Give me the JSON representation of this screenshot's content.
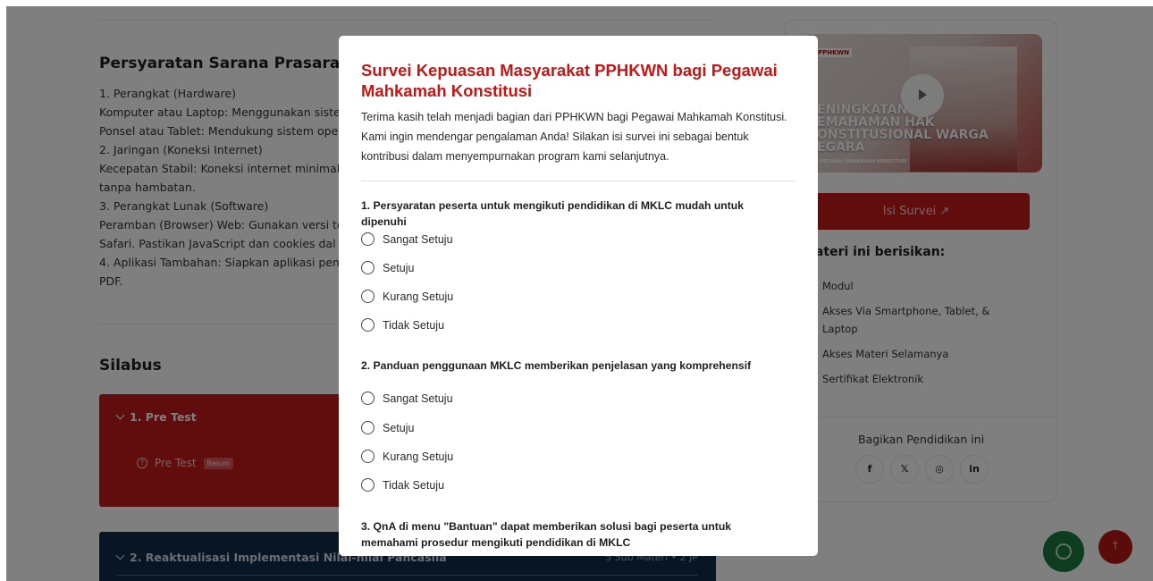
{
  "background": {
    "requirements": {
      "title": "Persyaratan Sarana Prasarana",
      "lines": [
        "1. Perangkat (Hardware)",
        "Komputer atau Laptop: Menggunakan siste",
        "Ponsel atau Tablet: Mendukung sistem ope",
        "2. Jaringan (Koneksi Internet)",
        "Kecepatan Stabil: Koneksi internet minimal",
        "tanpa hambatan.",
        "3. Perangkat Lunak (Software)",
        "Peramban (Browser) Web: Gunakan versi te",
        "Safari. Pastikan JavaScript dan cookies dal",
        "4. Aplikasi Tambahan: Siapkan aplikasi pem",
        "PDF."
      ]
    },
    "silabus": {
      "title": "Silabus",
      "sections": [
        {
          "title": "1. Pre Test",
          "items": [
            {
              "label": "Pre Test",
              "badge": "Belum"
            }
          ]
        },
        {
          "title": "2. Reaktualisasi Implementasi Nilai-nilai Pancasila",
          "meta": "5 Sub Materi • 2 JP"
        }
      ]
    },
    "sidebar": {
      "thumbnail": {
        "logo_text": "PPHKWN",
        "headline_lines": [
          "ENINGKATAN",
          "EMAHAMAN HAK",
          "ONSTITUSIONAL WARGA",
          "EGARA"
        ],
        "subtext": "I PEGAWAI MAHKAMAH KONSTITUSI"
      },
      "survey_button": "Isi Survei ↗",
      "materi_title": "Materi ini berisikan:",
      "materi_items": [
        {
          "icon": "file-icon",
          "glyph": "⊙",
          "label": "Modul"
        },
        {
          "icon": "device-icon",
          "glyph": "▯",
          "label": "Akses Via Smartphone, Tablet, & Laptop"
        },
        {
          "icon": "infinity-icon",
          "glyph": "∞",
          "label": "Akses Materi Selamanya"
        },
        {
          "icon": "certificate-icon",
          "glyph": "♧",
          "label": "Sertifikat Elektronik"
        }
      ],
      "share_title": "Bagikan Pendidikan ini",
      "share_icons": [
        {
          "name": "facebook-icon",
          "glyph": "f"
        },
        {
          "name": "x-icon",
          "glyph": "𝕏"
        },
        {
          "name": "instagram-icon",
          "glyph": "◎"
        },
        {
          "name": "linkedin-icon",
          "glyph": "in"
        }
      ]
    },
    "fab_top_glyph": "↑"
  },
  "modal": {
    "title": "Survei Kepuasan Masyarakat PPHKWN bagi Pegawai Mahkamah Konstitusi",
    "intro": "Terima kasih telah menjadi bagian dari PPHKWN bagi Pegawai Mahkamah Konstitusi. Kami ingin mendengar pengalaman Anda! Silakan isi survei ini sebagai bentuk kontribusi dalam menyempurnakan program kami selanjutnya.",
    "questions": [
      {
        "text": "1. Persyaratan peserta untuk mengikuti pendidikan di MKLC mudah untuk dipenuhi",
        "options": [
          "Sangat Setuju",
          "Setuju",
          "Kurang Setuju",
          "Tidak Setuju"
        ]
      },
      {
        "text": "2. Panduan penggunaan MKLC memberikan penjelasan yang komprehensif",
        "options": [
          "Sangat Setuju",
          "Setuju",
          "Kurang Setuju",
          "Tidak Setuju"
        ]
      },
      {
        "text": "3. QnA di menu \"Bantuan\" dapat memberikan solusi bagi peserta untuk memahami prosedur mengikuti pendidikan di MKLC"
      }
    ]
  }
}
